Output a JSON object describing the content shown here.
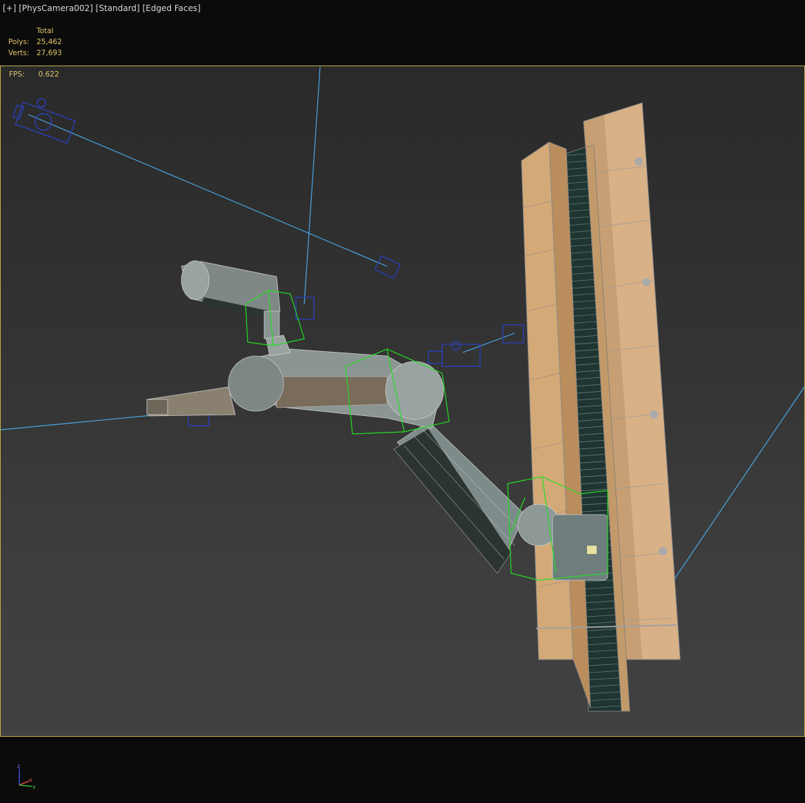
{
  "viewport_labels": {
    "plus": "[+]",
    "camera": "[PhysCamera002]",
    "shading": "[Standard]",
    "edges": "[Edged Faces]"
  },
  "stats": {
    "header": "Total",
    "polys_label": "Polys:",
    "polys_value": "25,462",
    "verts_label": "Verts:",
    "verts_value": "27,693"
  },
  "fps": {
    "label": "FPS:",
    "value": "0.622"
  },
  "axis_gizmo": {
    "z": "z",
    "x": "x",
    "y": "y"
  },
  "colors": {
    "accent_yellow": "#c8b04a",
    "stat_text": "#e2c66a",
    "wireframe_green": "#22e022",
    "camera_blue": "#2a3fb0",
    "light_line": "#4aa8e8"
  }
}
